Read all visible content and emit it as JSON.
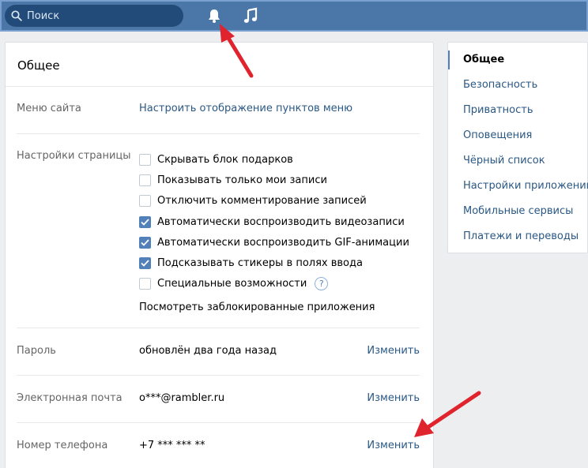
{
  "topbar": {
    "search_placeholder": "Поиск",
    "icons": [
      "search-icon",
      "bell-icon",
      "music-icon"
    ]
  },
  "main": {
    "title": "Общее",
    "menu_label": "Меню сайта",
    "menu_link": "Настроить отображение пунктов меню",
    "page_settings_label": "Настройки страницы",
    "checkboxes": [
      {
        "label": "Скрывать блок подарков",
        "checked": false
      },
      {
        "label": "Показывать только мои записи",
        "checked": false
      },
      {
        "label": "Отключить комментирование записей",
        "checked": false
      },
      {
        "label": "Автоматически воспроизводить видеозаписи",
        "checked": true
      },
      {
        "label": "Автоматически воспроизводить GIF-анимации",
        "checked": true
      },
      {
        "label": "Подсказывать стикеры в полях ввода",
        "checked": true
      },
      {
        "label": "Специальные возможности",
        "checked": false
      }
    ],
    "help_glyph": "?",
    "blocked_apps_link": "Посмотреть заблокированные приложения",
    "password_label": "Пароль",
    "password_value": "обновлён два года назад",
    "email_label": "Электронная почта",
    "email_value": "o***@rambler.ru",
    "phone_label": "Номер телефона",
    "phone_value": "+7 *** *** **",
    "change_label": "Изменить"
  },
  "sidebar": {
    "items": [
      {
        "label": "Общее",
        "active": true
      },
      {
        "label": "Безопасность",
        "active": false
      },
      {
        "label": "Приватность",
        "active": false
      },
      {
        "label": "Оповещения",
        "active": false
      },
      {
        "label": "Чёрный список",
        "active": false
      },
      {
        "label": "Настройки приложений",
        "active": false
      },
      {
        "label": "Мобильные сервисы",
        "active": false
      },
      {
        "label": "Платежи и переводы",
        "active": false
      }
    ]
  },
  "colors": {
    "header_bg": "#4a76a8",
    "link": "#2a5885",
    "accent": "#5181b8",
    "annotation_arrow": "#e0242d"
  }
}
